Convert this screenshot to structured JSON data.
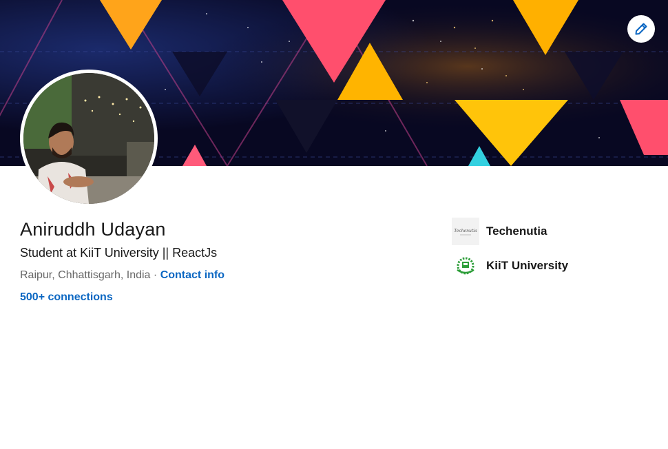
{
  "profile": {
    "name": "Aniruddh Udayan",
    "headline": "Student at KiiT University || ReactJs",
    "location": "Raipur, Chhattisgarh, India",
    "separator": "·",
    "contact_label": "Contact info",
    "connections_label": "500+ connections"
  },
  "organizations": [
    {
      "name": "Techenutia",
      "logo": "techenutia-logo",
      "logo_text": "Techenutia"
    },
    {
      "name": "KiiT University",
      "logo": "kiit-university-logo"
    }
  ],
  "actions": {
    "edit_banner_icon": "pencil-icon"
  },
  "colors": {
    "link": "#0a66c2",
    "text": "#191919",
    "muted": "#666666",
    "kiit_green": "#2e9e3a",
    "banner_pink": "#ff4f6d",
    "banner_yellow": "#ffb400",
    "banner_dark": "#0a0a2e"
  }
}
